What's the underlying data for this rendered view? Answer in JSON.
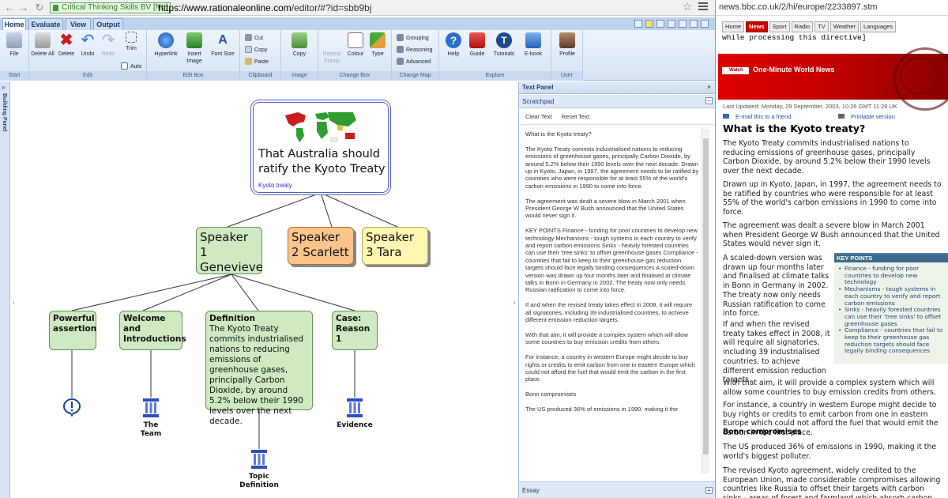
{
  "browser_left": {
    "site_badge": "Critical Thinking Skills BV [NL]",
    "url_host": "https://www.rationaleonline.com",
    "url_path": "/editor/#?id=sbb9bj"
  },
  "ribbon": {
    "tabs": [
      "Home",
      "Evaluate",
      "View",
      "Output"
    ],
    "groups": {
      "start": "Start",
      "edit": "Edit",
      "edit_box": "Edit Box",
      "clipboard": "Clipboard",
      "image": "Image",
      "change_box": "Change Box",
      "change_map": "Change Map",
      "explore": "Explore",
      "user": "User"
    },
    "buttons": {
      "file": "File",
      "delete_all": "Delete All",
      "delete": "Delete",
      "undo": "Undo",
      "redo": "Redo",
      "trim": "Trim",
      "auto": "Auto",
      "hyperlink": "Hyperlink",
      "insert_image": "Insert Image",
      "font_size": "Font Size",
      "cut": "Cut",
      "copy": "Copy",
      "paste": "Paste",
      "copy_image": "Copy",
      "repeat_stamp": "Repeat Stamp",
      "colour": "Colour",
      "type": "Type",
      "grouping": "Grouping",
      "reasoning": "Reasoning",
      "advanced": "Advanced",
      "help": "Help",
      "guide": "Guide",
      "tutorials": "Tutorials",
      "ebook": "E-book",
      "profile": "Profile"
    }
  },
  "building_panel": {
    "label": "Building Panel"
  },
  "map": {
    "claim": {
      "text": "That Australia should ratify the Kyoto Treaty",
      "link": "Kyoto treaty"
    },
    "speakers": [
      {
        "text": "Speaker 1 Genevieve",
        "color": "#cfe9c2"
      },
      {
        "text": "Speaker 2 Scarlett",
        "color": "#fbc48a"
      },
      {
        "text": "Speaker 3 Tara",
        "color": "#fdf7b3"
      }
    ],
    "reasons": [
      {
        "text": "Powerful assertion"
      },
      {
        "text": "Welcome and Introductions"
      },
      {
        "title": "Definition",
        "text": "The Kyoto Treaty commits industrialised nations to reducing emissions of greenhouse gases, principally Carbon Dioxide, by around 5.2% below their 1990 levels over the next decade."
      },
      {
        "text": "Case: Reason 1"
      }
    ],
    "bases": [
      "The Team",
      "Topic Definition",
      "Evidence"
    ]
  },
  "text_panel": {
    "title": "Text Panel",
    "scratchpad": "Scratchpad",
    "clear_text": "Clear Text",
    "reset_text": "Reset Text",
    "essay": "Essay",
    "paragraphs": [
      "What is the Kyoto treaty?",
      "The Kyoto Treaty commits industrialised nations to reducing emissions of greenhouse gases, principally Carbon Dioxide, by around 5.2% below their 1990 levels over the next decade. Drawn up in Kyoto, Japan, in 1997, the agreement needs to be ratified by countries who were responsible for at least 55% of the world's carbon emissions in 1990 to come into force.",
      "The agreement was dealt a severe blow in March 2001 when President George W Bush announced that the United States would never sign it.",
      "KEY POINTS Finance - funding for poor countries to develop new technology Mechanisms - tough systems in each country to verify and report carbon emissions Sinks - heavily forested countries can use their 'tree sinks' to offset greenhouse gases Compliance - countries that fail to keep to their greenhouse gas reduction targets should face legally binding consequences A scaled-down version was drawn up four months later and finalised at climate talks in Bonn in Germany in 2002. The treaty now only needs Russian ratification to come into force.",
      "If and when the revised treaty takes effect in 2008, it will require all signatories, including 39 industrialised countries, to achieve different emission reduction targets.",
      "With that aim, it will provide a complex system which will allow some countries to buy emission credits from others.",
      "For instance, a country in western Europe might decide to buy rights or credits to emit carbon from one in eastern Europe which could not afford the fuel that would emit the carbon in the first place.",
      "Bonn compromises",
      "The US produced 36% of emissions in 1990, making it the"
    ]
  },
  "browser_right": {
    "url": "news.bbc.co.uk/2/hi/europe/2233897.stm",
    "tabs": [
      "Home",
      "News",
      "Sport",
      "Radio",
      "TV",
      "Weather",
      "Languages"
    ],
    "directive": "while processing this directive]",
    "watch": "Watch",
    "banner": "One-Minute World News",
    "updated": "Last Updated: Monday, 29 September, 2003, 10:26 GMT 11:26 UK",
    "email": "E-mail this to a friend",
    "print": "Printable version",
    "headline": "What is the Kyoto treaty?",
    "p1": "The Kyoto Treaty commits industrialised nations to reducing emissions of greenhouse gases, principally Carbon Dioxide, by around 5.2% below their 1990 levels over the next decade.",
    "p2": "Drawn up in Kyoto, Japan, in 1997, the agreement needs to be ratified by countries who were responsible for at least 55% of the world's carbon emissions in 1990 to come into force.",
    "p3": "The agreement was dealt a severe blow in March 2001 when President George W Bush announced that the United States would never sign it.",
    "p4": "A scaled-down version was drawn up four months later and finalised at climate talks in Bonn in Germany in 2002. The treaty now only needs Russian ratification to come into force.",
    "p5": "If and when the revised treaty takes effect in 2008, it will require all signatories, including 39 industrialised countries, to achieve different emission reduction targets.",
    "p6": "With that aim, it will provide a complex system which will allow some countries to buy emission credits from others.",
    "p7": "For instance, a country in western Europe might decide to buy rights or credits to emit carbon from one in eastern Europe which could not afford the fuel that would emit the carbon in the first place.",
    "h2": "Bonn compromises",
    "p8": "The US produced 36% of emissions in 1990, making it the world's biggest polluter.",
    "p9": "The revised Kyoto agreement, widely credited to the European Union, made considerable compromises allowing countries like Russia to offset their targets with carbon sinks - areas of forest and farmland which absorb carbon through",
    "key_points_title": "KEY POINTS",
    "key_points": [
      "Finance - funding for poor countries to develop new technology",
      "Mechanisms - tough systems in each country to verify and report carbon emissions",
      "Sinks - heavily forested countries can use their 'tree sinks' to offset greenhouse gases",
      "Compliance - countries that fail to keep to their greenhouse gas reduction targets should face legally binding consequences"
    ]
  },
  "colors": {
    "ribbon": "#d6e3f4",
    "green_box": "#cfe9c2",
    "orange_box": "#fbc48a",
    "yellow_box": "#fdf7b3",
    "claim_border": "#5360c6",
    "bbc_red": "#c00000"
  }
}
